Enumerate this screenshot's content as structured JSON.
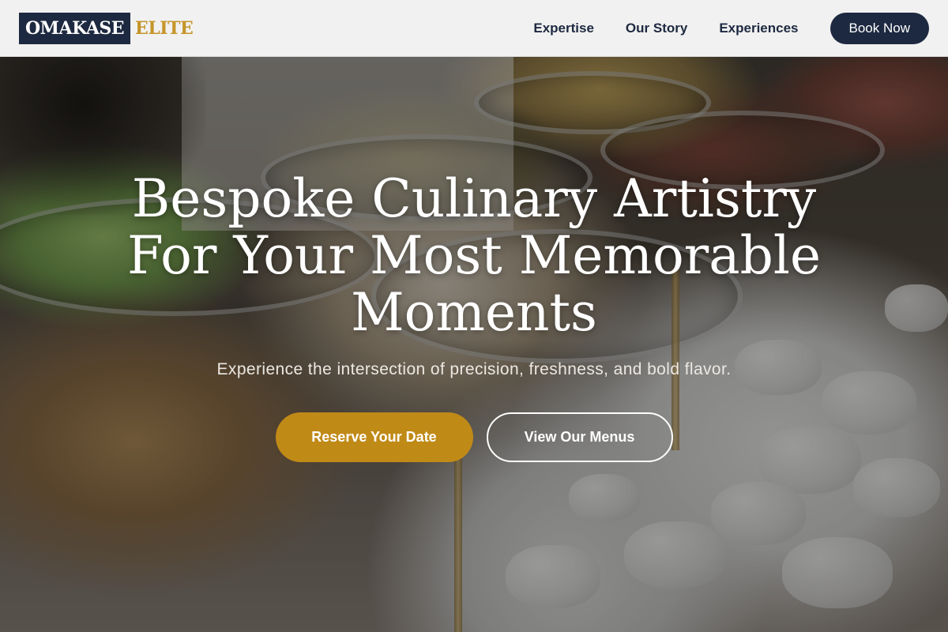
{
  "header": {
    "logo_primary": "OMAKASE",
    "logo_accent": "ELITE",
    "nav": [
      {
        "label": "Expertise"
      },
      {
        "label": "Our Story"
      },
      {
        "label": "Experiences"
      }
    ],
    "cta_label": "Book Now"
  },
  "hero": {
    "title_line1": "Bespoke Culinary Artistry",
    "title_line2": "For Your Most Memorable",
    "title_line3": "Moments",
    "subtitle": "Experience the intersection of precision, freshness, and bold flavor.",
    "primary_cta": "Reserve Your Date",
    "secondary_cta": "View Our Menus"
  },
  "colors": {
    "navy": "#1d2940",
    "gold": "#c5952a",
    "button_gold": "#c08a17",
    "nav_background": "#f1f1f1"
  },
  "icons": {
    "hero_image": "catering-buffet-photo"
  }
}
